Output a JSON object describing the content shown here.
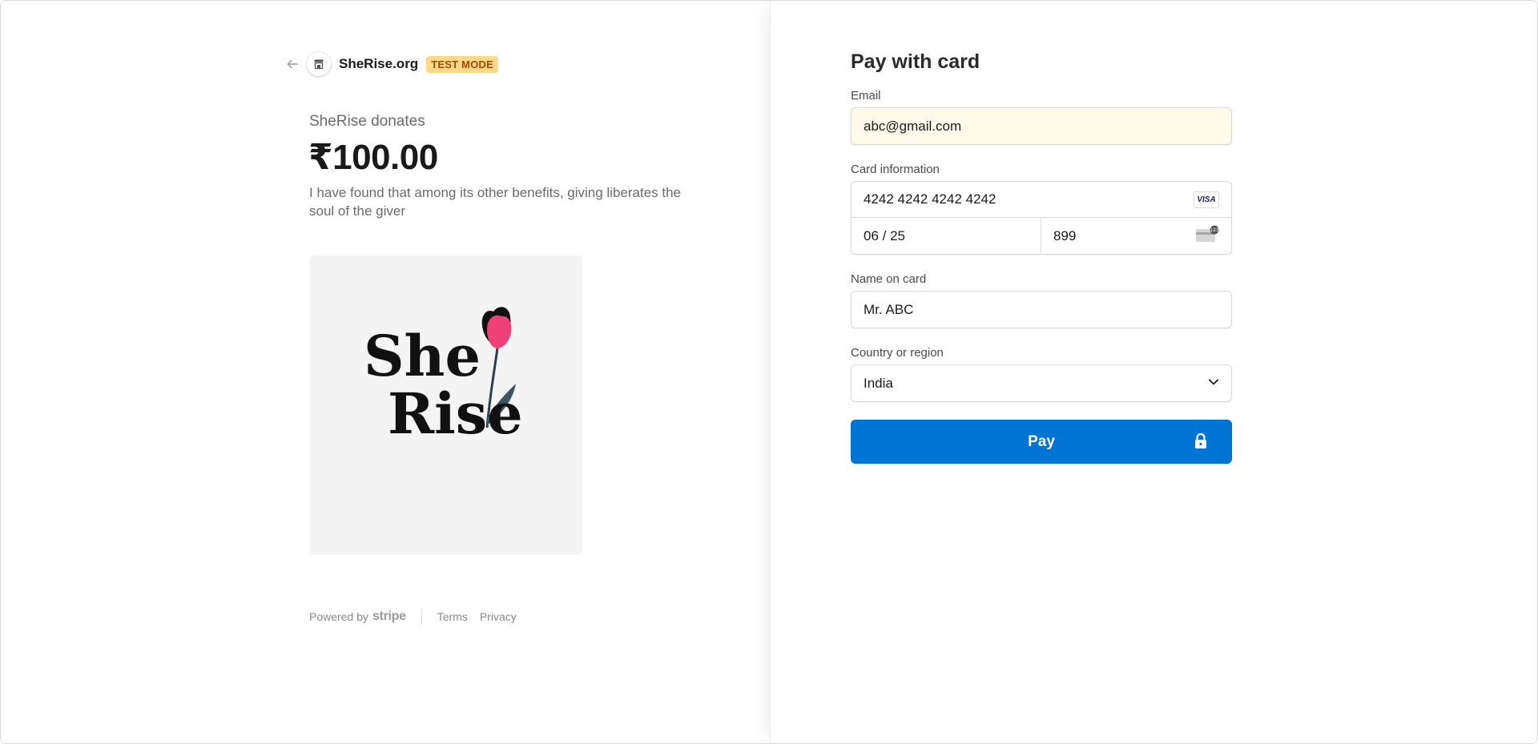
{
  "header": {
    "merchant_name": "SheRise.org",
    "test_badge": "TEST MODE"
  },
  "product": {
    "name": "SheRise donates",
    "amount": "₹100.00",
    "description": "I have found that among its other benefits, giving liberates the soul of the giver",
    "logo_lines": [
      "She",
      "Rise"
    ]
  },
  "footer": {
    "powered_by": "Powered by",
    "stripe": "stripe",
    "terms": "Terms",
    "privacy": "Privacy"
  },
  "form": {
    "title": "Pay with card",
    "email_label": "Email",
    "email_value": "abc@gmail.com",
    "card_label": "Card information",
    "card_number": "4242 4242 4242 4242",
    "card_brand": "VISA",
    "expiry": "06 / 25",
    "cvc": "899",
    "name_label": "Name on card",
    "name_value": "Mr. ABC",
    "country_label": "Country or region",
    "country_value": "India",
    "pay_label": "Pay"
  },
  "colors": {
    "accent": "#0074d4",
    "badge_bg": "#ffd98a",
    "badge_text": "#a04a00",
    "autofill_bg": "#fffbea",
    "tulip": "#f0407a"
  },
  "icons": [
    "back-arrow-icon",
    "store-icon",
    "visa-icon",
    "cvc-card-icon",
    "chevron-down-icon",
    "lock-icon"
  ]
}
